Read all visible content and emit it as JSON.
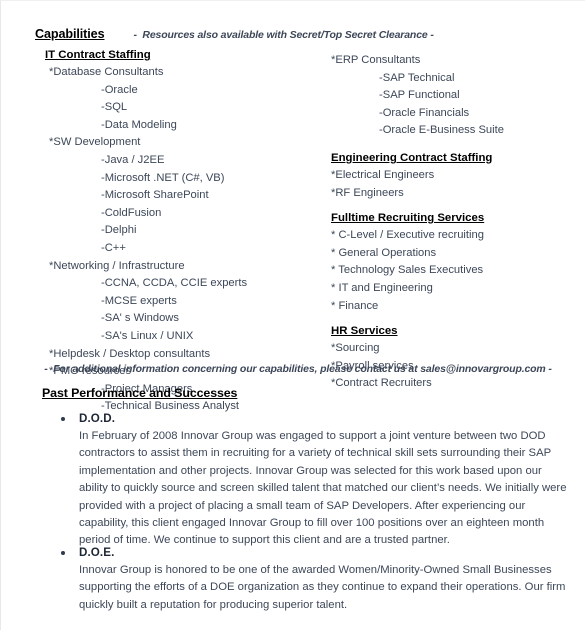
{
  "document": {
    "capabilities": {
      "title": "Capabilities",
      "clearance_note": "-  Resources also available with Secret/Top Secret Clearance -",
      "left_column": [
        {
          "type": "heading",
          "text": "IT Contract Staffing"
        },
        {
          "type": "level1",
          "text": "*Database Consultants"
        },
        {
          "type": "level2",
          "text": "-Oracle"
        },
        {
          "type": "level2",
          "text": "-SQL"
        },
        {
          "type": "level2",
          "text": "-Data Modeling"
        },
        {
          "type": "level1",
          "text": "*SW Development"
        },
        {
          "type": "level2",
          "text": "-Java / J2EE"
        },
        {
          "type": "level2",
          "text": "-Microsoft .NET (C#, VB)"
        },
        {
          "type": "level2",
          "text": "-Microsoft SharePoint"
        },
        {
          "type": "level2",
          "text": "-ColdFusion"
        },
        {
          "type": "level2",
          "text": "-Delphi"
        },
        {
          "type": "level2",
          "text": "-C++"
        },
        {
          "type": "level1",
          "text": "*Networking / Infrastructure"
        },
        {
          "type": "level2",
          "text": "-CCNA, CCDA, CCIE experts"
        },
        {
          "type": "level2",
          "text": "-MCSE experts"
        },
        {
          "type": "level2",
          "text": "-SA' s Windows"
        },
        {
          "type": "level2",
          "text": "-SA's Linux / UNIX"
        },
        {
          "type": "level1",
          "text": "*Helpdesk / Desktop consultants"
        },
        {
          "type": "level1",
          "text": "*PMO resources"
        },
        {
          "type": "level2",
          "text": "-Project Managers"
        },
        {
          "type": "level2",
          "text": "-Technical Business Analyst"
        }
      ],
      "right_groups": [
        {
          "heading": null,
          "items": [
            {
              "type": "level1",
              "text": "*ERP Consultants"
            },
            {
              "type": "level2",
              "text": "-SAP Technical"
            },
            {
              "type": "level2",
              "text": "-SAP Functional"
            },
            {
              "type": "level2",
              "text": "-Oracle Financials"
            },
            {
              "type": "level2",
              "text": "-Oracle E-Business Suite"
            }
          ]
        },
        {
          "heading": "Engineering Contract Staffing",
          "items": [
            {
              "type": "level1",
              "text": "*Electrical Engineers"
            },
            {
              "type": "level1",
              "text": "*RF Engineers"
            }
          ]
        },
        {
          "heading": "Fulltime Recruiting Services",
          "items": [
            {
              "type": "level1",
              "text": "* C-Level / Executive recruiting"
            },
            {
              "type": "level1",
              "text": "* General Operations"
            },
            {
              "type": "level1",
              "text": "* Technology Sales Executives"
            },
            {
              "type": "level1",
              "text": "* IT and Engineering"
            },
            {
              "type": "level1",
              "text": "* Finance"
            }
          ]
        },
        {
          "heading": "HR Services",
          "items": [
            {
              "type": "level1",
              "text": "*Sourcing"
            },
            {
              "type": "level1",
              "text": "*Payroll services"
            },
            {
              "type": "level1",
              "text": "*Contract Recruiters"
            }
          ]
        }
      ],
      "contact_note": "-  For additional information concerning our capabilities, please contact us at sales@innovargroup.com -"
    },
    "past_performance": {
      "title": "Past Performance and Successes",
      "entries": [
        {
          "name": "D.O.D.",
          "text": "In February of 2008 Innovar Group was engaged to support a joint venture between two DOD contractors to assist them in recruiting for a variety of technical skill sets surrounding their SAP implementation and other projects.  Innovar Group was selected for this work based upon our ability to quickly source and screen skilled talent that matched our client’s needs.  We initially were provided with a project of placing a small team of SAP Developers.  After experiencing our capability, this client engaged Innovar Group to fill over 100 positions over an eighteen month period of time.  We continue to support this client and are a trusted partner."
        },
        {
          "name": "D.O.E.",
          "text": "Innovar Group is honored to be one of the awarded Women/Minority-Owned Small Businesses supporting the efforts of a DOE organization as they continue to expand their operations.  Our firm quickly built a reputation for producing superior talent."
        }
      ]
    }
  }
}
